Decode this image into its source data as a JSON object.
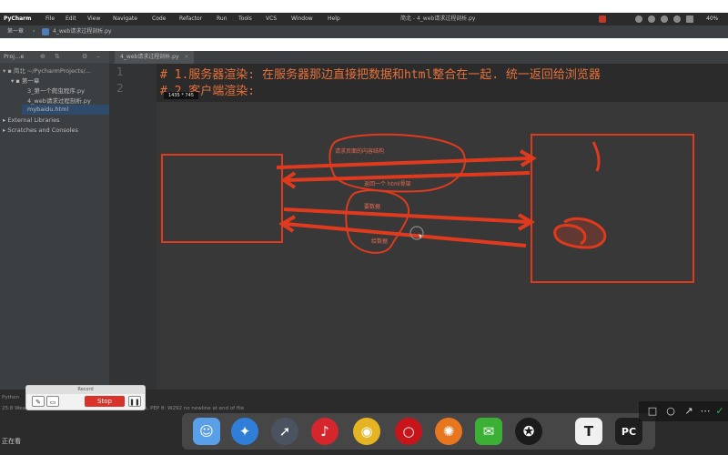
{
  "menubar": {
    "app": "PyCharm",
    "items": [
      "File",
      "Edit",
      "View",
      "Navigate",
      "Code",
      "Refactor",
      "Run",
      "Tools",
      "VCS",
      "Window",
      "Help"
    ],
    "window_title": "简北 - 4_web请求过程剖析.py",
    "battery": "40%"
  },
  "navbar": {
    "crumbs": [
      "第一章",
      "4_web请求过程剖析.py"
    ]
  },
  "sidebar": {
    "header": "Proj...e",
    "items": [
      "简北 ~/PycharmProjects/...",
      "第一章",
      "3_第一个爬虫程序.py",
      "4_web请求过程剖析.py",
      "mybaidu.html",
      "External Libraries",
      "Scratches and Consoles"
    ]
  },
  "editor": {
    "tab": "4_web请求过程剖析.py",
    "line_numbers": [
      "1",
      "2"
    ],
    "lines": [
      "# 1.服务器渲染: 在服务器那边直接把数据和html整合在一起. 统一返回给浏览器",
      "# 2.客户端渲染:"
    ],
    "tooltip": "1435 * 745"
  },
  "annotations": {
    "top_request": "请求页面的内容结构",
    "top_response": "返回一个 html骨架",
    "bottom_request": "要数据",
    "bottom_response": "给数据"
  },
  "status": {
    "text": "25:8  Weak warning: PEP 8: W292 no newline at end of file, PEP 8: W292 no newline at end of file",
    "run_label": "Python",
    "bottom_left": "正在看"
  },
  "recorder": {
    "title": "Record",
    "stop_label": "Stop"
  },
  "dock": {
    "apps": [
      "finder-icon",
      "safari-icon",
      "launchpad-icon",
      "netease-music-icon",
      "chrome-icon",
      "opera-icon",
      "firefox-icon",
      "wechat-icon",
      "qq-icon",
      "typora-icon",
      "pycharm-icon"
    ],
    "typora_glyph": "T",
    "pycharm_glyph": "PC"
  },
  "colors": {
    "ide_bg": "#2b2b2b",
    "annotation_red": "#e03a1e",
    "code_orange": "#e8713a",
    "stop_red": "#d9322b"
  }
}
